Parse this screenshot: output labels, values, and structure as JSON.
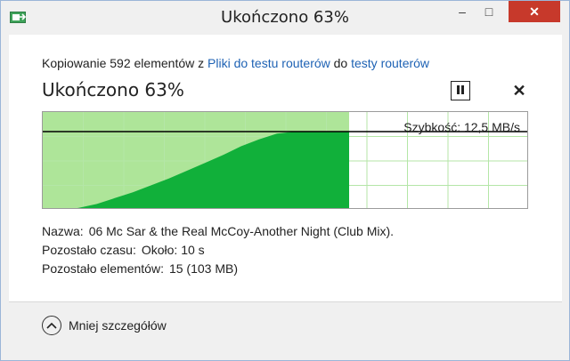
{
  "window": {
    "title": "Ukończono 63%",
    "controls": {
      "minimize": "–",
      "maximize": "□",
      "close": "✕"
    }
  },
  "copy_info": {
    "prefix": "Kopiowanie 592 elementów z ",
    "source_link": "Pliki do testu routerów",
    "middle": " do ",
    "destination_link": "testy routerów"
  },
  "status": {
    "headline": "Ukończono 63%",
    "pause_icon": "pause-icon",
    "cancel_icon": "close-icon"
  },
  "chart_data": {
    "type": "area",
    "progress_fraction": 0.63,
    "speed_label": "Szybkość: 12,5 MB/s",
    "grid": true,
    "colors": {
      "done_bg": "#aee599",
      "area": "#11b03a",
      "grid": "#b4e6a7",
      "line": "#000000"
    },
    "area_profile": [
      0,
      0,
      0.02,
      0.06,
      0.12,
      0.18,
      0.25,
      0.32,
      0.4,
      0.48,
      0.56,
      0.65,
      0.72,
      0.78,
      0.8,
      0.8,
      0.8,
      0.8
    ],
    "speed_line_level": 0.8
  },
  "details": {
    "name_label": "Nazwa:",
    "name_value": "06 Mc Sar & the Real McCoy-Another Night (Club Mix).",
    "time_label": "Pozostało czasu:",
    "time_value": "Około: 10 s",
    "items_label": "Pozostało elementów:",
    "items_value": "15 (103 MB)"
  },
  "footer": {
    "less_details": "Mniej szczegółów",
    "toggle_icon": "chevron-up-icon"
  }
}
